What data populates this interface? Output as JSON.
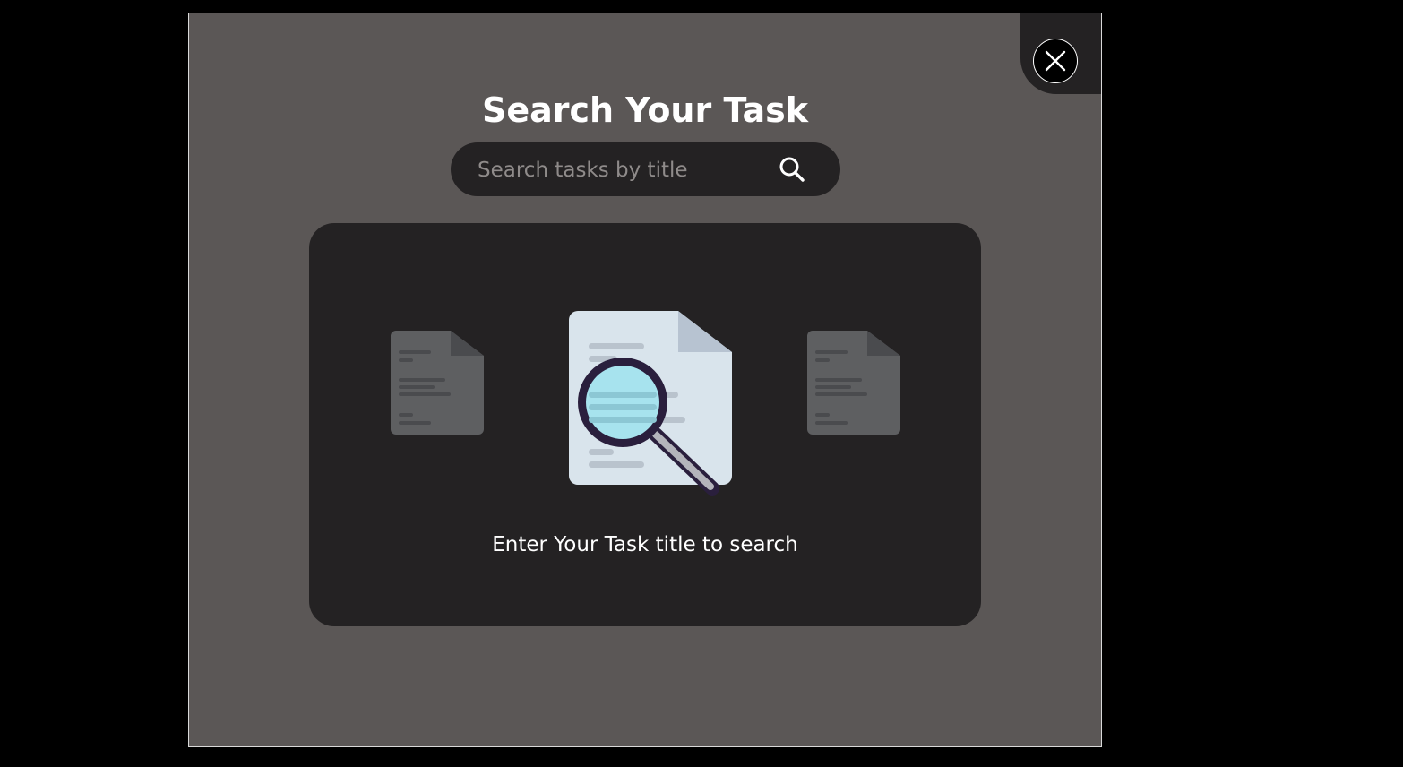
{
  "modal": {
    "title": "Search Your Task",
    "close_icon": "close-icon"
  },
  "search": {
    "placeholder": "Search tasks by title",
    "value": "",
    "icon": "search-icon"
  },
  "empty_state": {
    "message": "Enter Your Task title to search",
    "illustration": "document-magnifier-illustration"
  },
  "colors": {
    "page_background": "#000000",
    "modal_background": "#5b5756",
    "panel_background": "#242223",
    "text": "#ffffff"
  }
}
